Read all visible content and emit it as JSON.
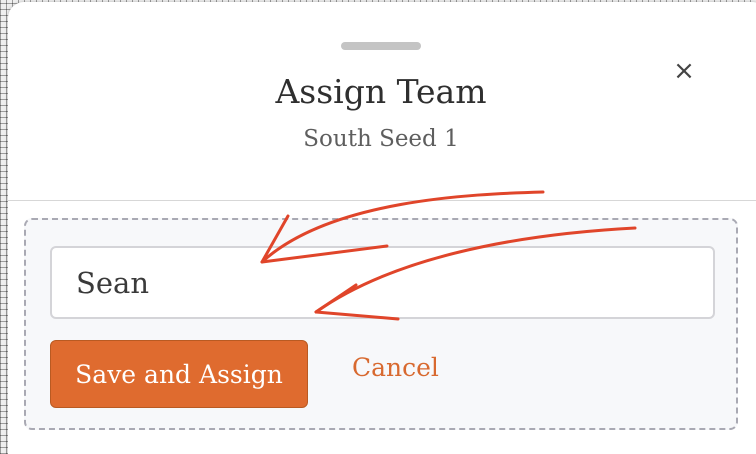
{
  "modal": {
    "title": "Assign Team",
    "subtitle": "South Seed 1",
    "close_glyph": "×",
    "close_icon": "close-icon"
  },
  "form": {
    "name_value": "Sean",
    "save_label": "Save and Assign",
    "cancel_label": "Cancel"
  },
  "colors": {
    "accent": "#df6b2f",
    "annotation_arrow": "#e0452a"
  }
}
